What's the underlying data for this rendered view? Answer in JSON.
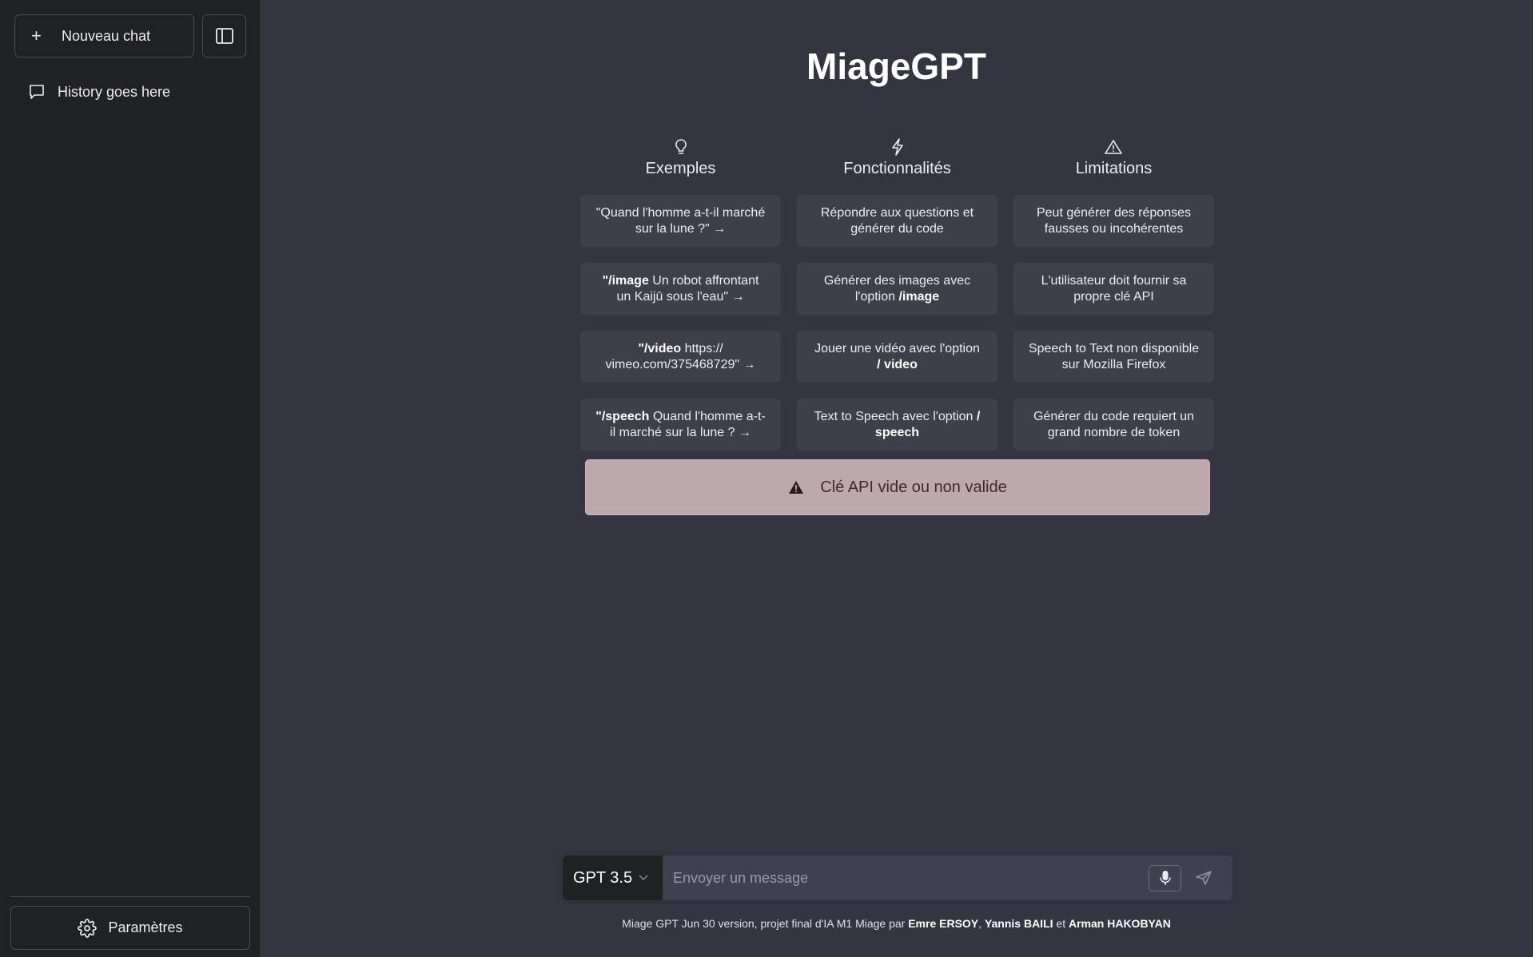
{
  "sidebar": {
    "new_chat_label": "Nouveau chat",
    "history_item": "History goes here",
    "settings_label": "Paramètres"
  },
  "main": {
    "title": "MiageGPT",
    "columns": [
      {
        "icon": "lightbulb-icon",
        "title": "Exemples",
        "cards": [
          {
            "bold": "",
            "text": "\"Quand l'homme a-t-il marché sur la lune ?\" →"
          },
          {
            "bold": "\"/image",
            "text": " Un robot affrontant un Kaijū sous l'eau\" →"
          },
          {
            "bold": "\"/video",
            "text": " https:// vimeo.com/375468729\" →"
          },
          {
            "bold": "\"/speech",
            "text": " Quand l'homme a-t-il marché sur la lune ? →"
          }
        ]
      },
      {
        "icon": "lightning-icon",
        "title": "Fonctionnalités",
        "cards": [
          {
            "pre": "Répondre aux questions et générer du code",
            "bold": ""
          },
          {
            "pre": "Générer des images avec l'option ",
            "bold": "/image"
          },
          {
            "pre": "Jouer une vidéo avec l'option ",
            "bold": "/ video"
          },
          {
            "pre": "Text to Speech avec l'option ",
            "bold": "/ speech"
          }
        ]
      },
      {
        "icon": "warning-icon",
        "title": "Limitations",
        "cards": [
          "Peut générer des réponses fausses ou incohérentes",
          "L'utilisateur doit fournir sa propre clé API",
          "Speech to Text non disponible sur Mozilla Firefox",
          "Générer du code requiert un grand nombre de token"
        ]
      }
    ],
    "error_banner": "Clé API vide ou non valide"
  },
  "input": {
    "model": "GPT 3.5",
    "placeholder": "Envoyer un message"
  },
  "footer": {
    "prefix": "Miage GPT Jun 30 version, projet final d'IA M1 Miage par ",
    "author1": "Emre ERSOY",
    "sep1": ", ",
    "author2": "Yannis BAILI",
    "sep2": " et ",
    "author3": "Arman HAKOBYAN"
  },
  "colors": {
    "sidebar_bg": "#202123",
    "main_bg": "#343541",
    "card_bg": "#3e3f4b",
    "error_bg": "#bda8ad",
    "error_text": "#4a2530"
  }
}
